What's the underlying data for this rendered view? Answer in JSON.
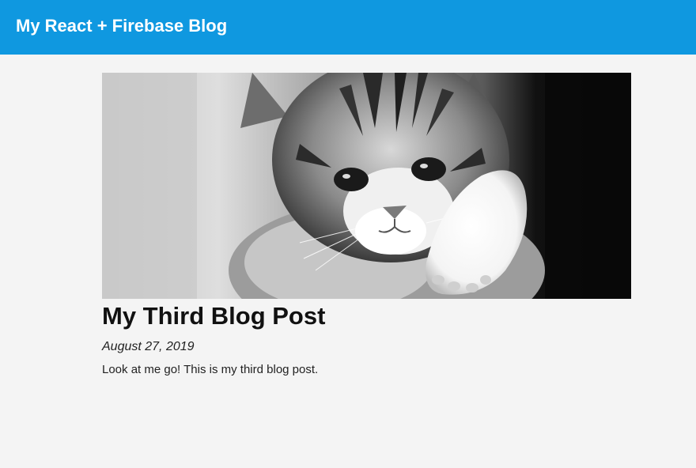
{
  "header": {
    "title": "My React + Firebase Blog"
  },
  "post": {
    "image_alt": "kitten",
    "title": "My Third Blog Post",
    "date": "August 27, 2019",
    "body": "Look at me go! This is my third blog post."
  },
  "colors": {
    "header_bg": "#0f98e0",
    "page_bg": "#f4f4f4"
  }
}
